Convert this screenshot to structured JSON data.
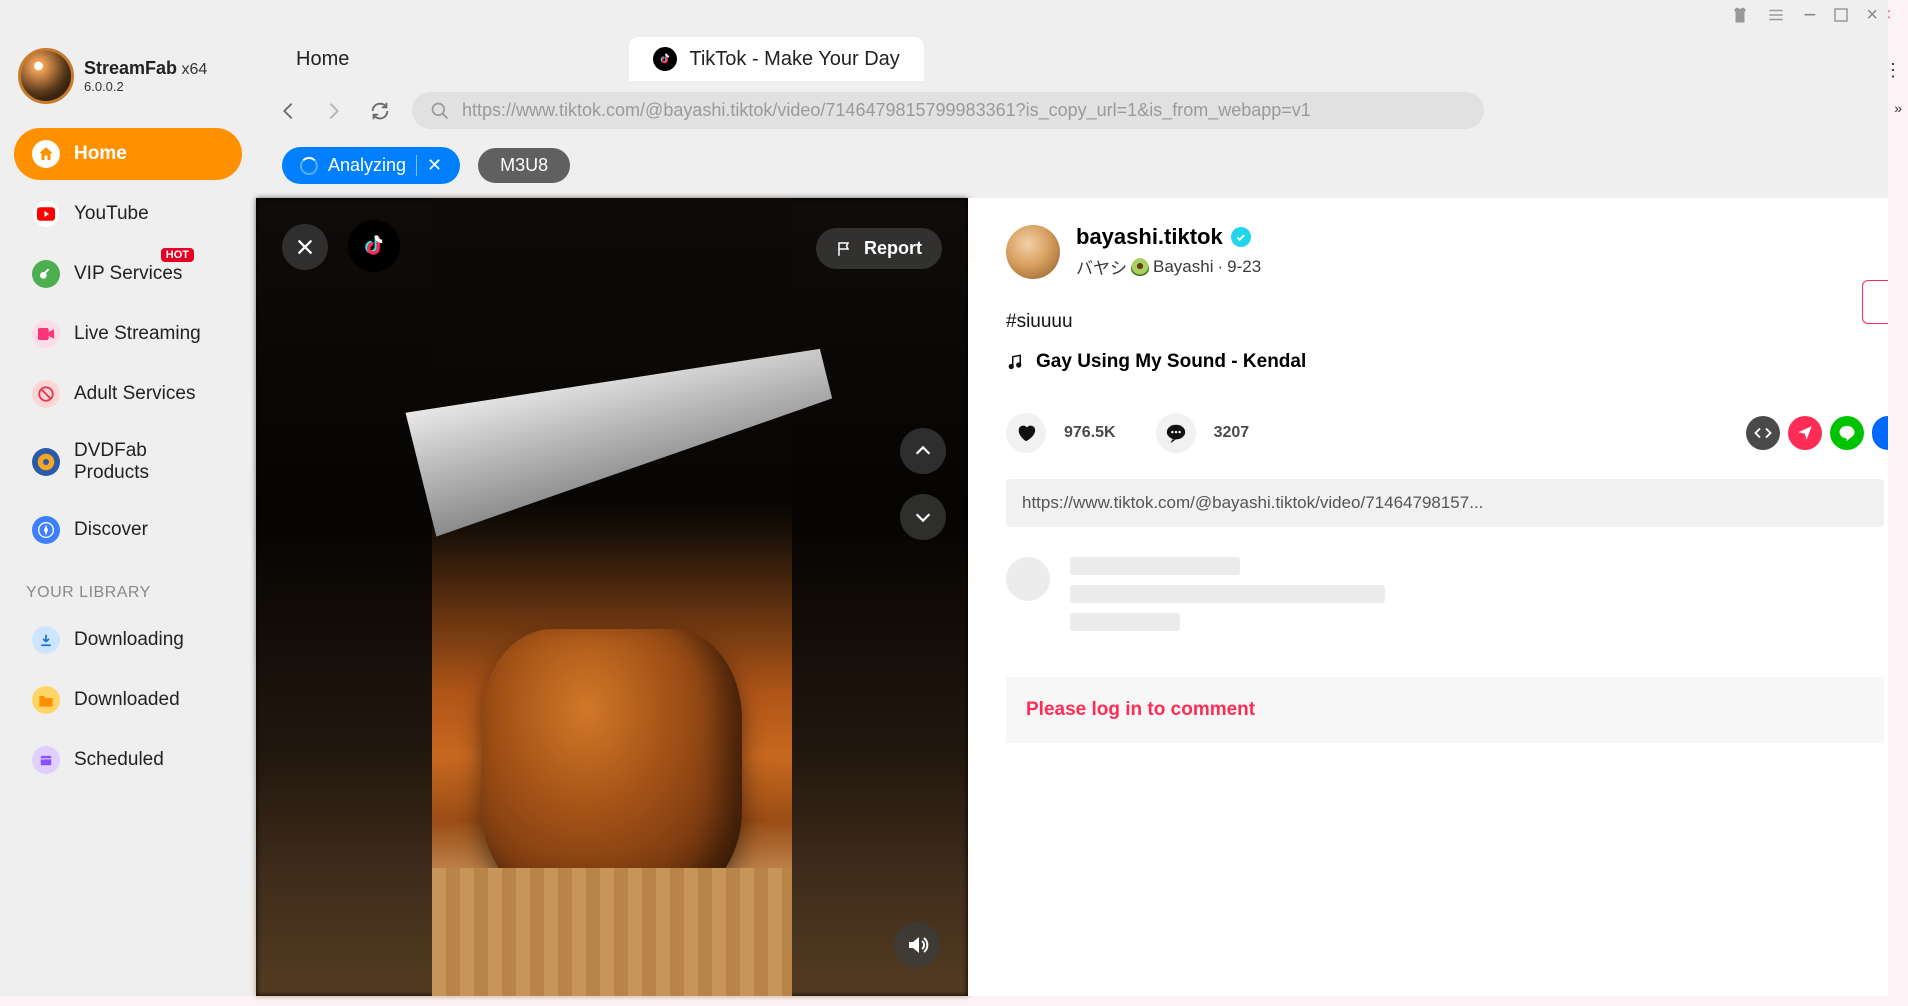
{
  "app": {
    "name": "StreamFab",
    "arch": "x64",
    "version": "6.0.0.2"
  },
  "sidebar": {
    "items": [
      {
        "label": "Home"
      },
      {
        "label": "YouTube"
      },
      {
        "label": "VIP Services",
        "badge": "HOT"
      },
      {
        "label": "Live Streaming"
      },
      {
        "label": "Adult Services"
      },
      {
        "label": "DVDFab Products"
      },
      {
        "label": "Discover"
      }
    ],
    "library_header": "YOUR LIBRARY",
    "library": [
      {
        "label": "Downloading"
      },
      {
        "label": "Downloaded"
      },
      {
        "label": "Scheduled"
      }
    ]
  },
  "tabs": {
    "home": "Home",
    "tiktok": "TikTok - Make Your Day"
  },
  "address": {
    "url": "https://www.tiktok.com/@bayashi.tiktok/video/7146479815799983361?is_copy_url=1&is_from_webapp=v1"
  },
  "status": {
    "analyzing": "Analyzing",
    "m3u8": "M3U8"
  },
  "video": {
    "report": "Report"
  },
  "post": {
    "username": "bayashi.tiktok",
    "display_pre": "バヤシ",
    "display_post": "Bayashi",
    "date": "9-23",
    "caption": "#siuuuu",
    "sound": "Gay Using My Sound - Kendal",
    "likes": "976.5K",
    "comments": "3207",
    "url_short": "https://www.tiktok.com/@bayashi.tiktok/video/71464798157...",
    "login_prompt": "Please log in to comment"
  }
}
